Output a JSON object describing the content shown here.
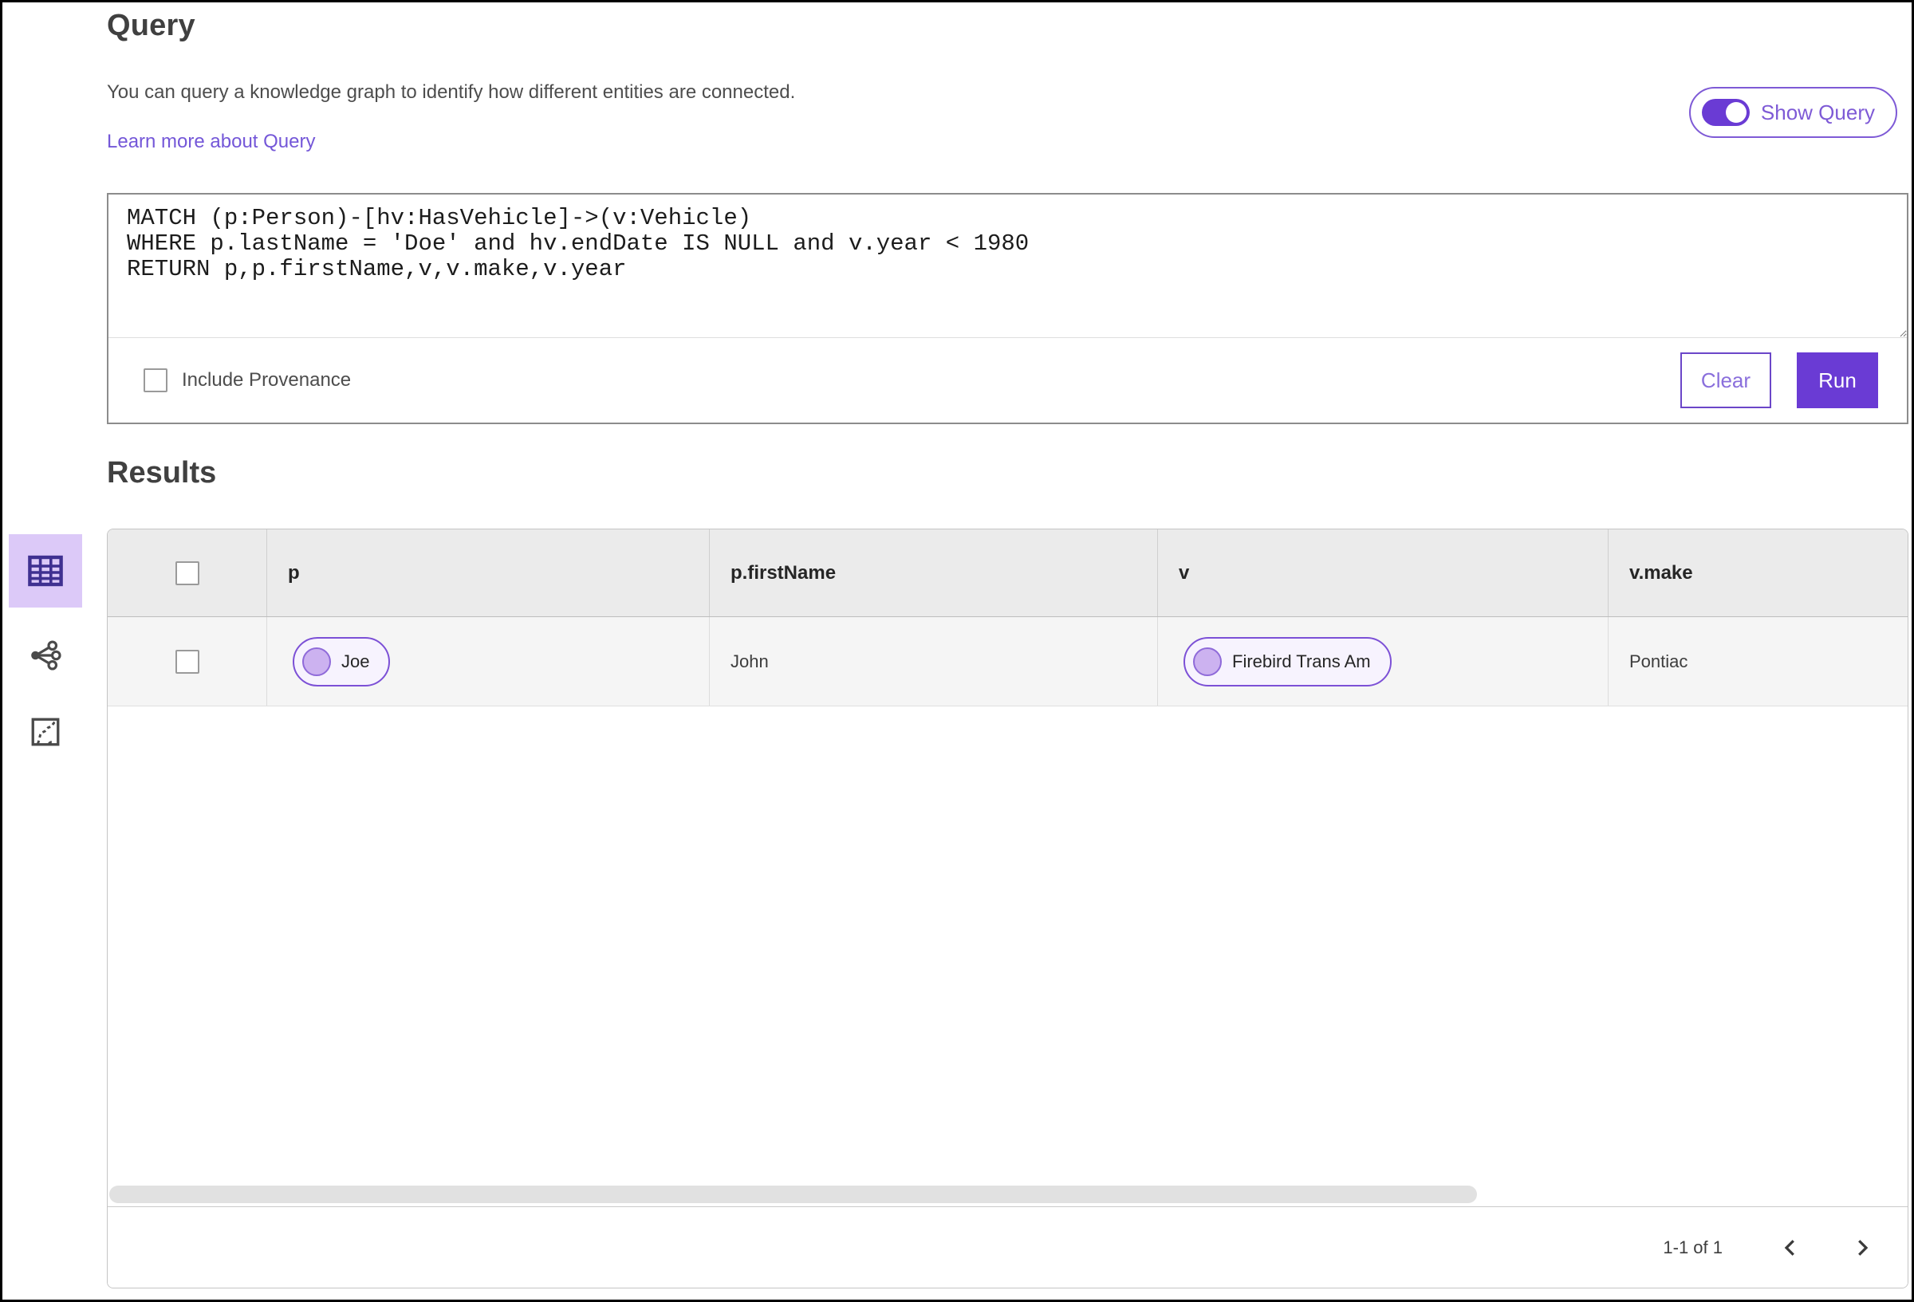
{
  "page": {
    "title": "Query",
    "description": "You can query a knowledge graph to identify how different entities are connected.",
    "learn_more_label": "Learn more about Query",
    "show_query_label": "Show Query",
    "show_query_on": true
  },
  "query_editor": {
    "text": "MATCH (p:Person)-[hv:HasVehicle]->(v:Vehicle)\nWHERE p.lastName = 'Doe' and hv.endDate IS NULL and v.year < 1980\nRETURN p,p.firstName,v,v.make,v.year",
    "include_provenance_label": "Include Provenance",
    "include_provenance_checked": false,
    "clear_label": "Clear",
    "run_label": "Run"
  },
  "results": {
    "title": "Results",
    "view_switcher": [
      {
        "name": "table-view",
        "icon": "table-icon",
        "selected": true
      },
      {
        "name": "network-view",
        "icon": "network-icon",
        "selected": false
      },
      {
        "name": "map-view",
        "icon": "map-icon",
        "selected": false
      }
    ],
    "table": {
      "columns": [
        "p",
        "p.firstName",
        "v",
        "v.make"
      ],
      "rows": [
        {
          "selected": false,
          "cells": [
            {
              "type": "entity",
              "label": "Joe"
            },
            {
              "type": "text",
              "label": "John"
            },
            {
              "type": "entity",
              "label": "Firebird Trans Am"
            },
            {
              "type": "text",
              "label": "Pontiac"
            }
          ]
        }
      ]
    },
    "pagination": {
      "range_label": "1-1 of 1"
    }
  },
  "colors": {
    "primary_purple": "#6a3bd4",
    "link_purple": "#7457d8",
    "outline_purple": "#7e5ad6",
    "pill_border": "#7c50d6",
    "pill_bg": "#f7f3fe",
    "pill_dot": "#ccb2f0",
    "selected_rail_bg": "#dcc9f8",
    "header_bg": "#ebebeb",
    "row_bg": "#f5f5f5",
    "frame_border": "#000000"
  }
}
